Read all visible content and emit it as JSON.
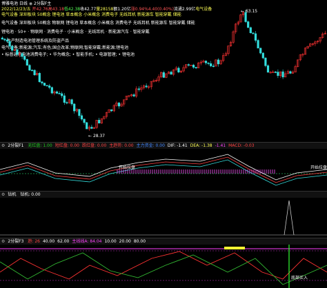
{
  "title_bar": {
    "text": "博雅电池 日线",
    "indicator": "2分裂F主"
  },
  "info_line": {
    "date": "2022/12/23/五",
    "items": [
      {
        "text": "开42.76",
        "color": "#ff5555"
      },
      {
        "text": "高43.18",
        "color": "#ff5555"
      },
      {
        "text": "低42.38",
        "color": "#55ff55"
      },
      {
        "text": "收42.77",
        "color": "#ffffff"
      },
      {
        "text": "量28158",
        "color": "#ffff55"
      },
      {
        "text": "额1.20亿",
        "color": "#ffffff"
      },
      {
        "text": "涨0.94%",
        "color": "#ff5555"
      },
      {
        "text": "4.40(0.40%)",
        "color": "#ff5555"
      },
      {
        "text": "流通2.99亿",
        "color": "#ffffff"
      },
      {
        "text": "电气设备",
        "color": "#ffff55"
      }
    ]
  },
  "concept_lines": [
    {
      "text": "电气设备  深圳板块  50概念  锂电池  草本概念  小米概念  消费电子  无线耳机  新能源车  智能穿戴  储能",
      "color": "#ffff55"
    },
    {
      "text": "电气设备  深圳板块  50概念  物联网  锂电池  草本概念  小米概念  消费电子  无线耳机  新能源车  智能穿戴  储能",
      "color": "#ffffff"
    },
    {
      "text": "锂电池  ·  50+  ·  物联网  ·  消费电子  ·  小米概念  ·  无线耳机  ·  新能源汽车  ·  智能穿戴",
      "color": "#ffffff"
    }
  ],
  "business_lines": [
    "生产制造电池管理系统及防盗产品",
    "电气设备;新能源;汽车;有色;国企改革;物联网;智能穿戴;新能源;锂电池",
    "•  标普通用电池消费电子;  •  华为概念;  •  智能手机;  •  电源管理;  •  锂电池"
  ],
  "price_annotations": {
    "high": "63.15",
    "low": "28.37"
  },
  "macd_header": {
    "name": "2分裂F1",
    "items": [
      {
        "text": "无红盘: 1.00",
        "color": "#22cc22"
      },
      {
        "text": "短红盘: 0.00",
        "color": "#ff4444"
      },
      {
        "text": "跌红盘: 0.00",
        "color": "#ff4444"
      },
      {
        "text": "主趋势: 0.00",
        "color": "#ff4444"
      },
      {
        "text": "主力资金: 0.00",
        "color": "#4488ff"
      },
      {
        "text": "DIF: -1.41",
        "color": "#ffffff"
      },
      {
        "text": "DEA: -1.38",
        "color": "#ffff55"
      },
      {
        "text": "-1.41",
        "color": "#ff44ff"
      },
      {
        "text": "MACD: -0.03",
        "color": "#ff4444"
      }
    ],
    "labels": [
      "开始拉盘",
      "开始拉盘"
    ]
  },
  "signal_header": {
    "name": "钻机",
    "value_label": "钻机: 0.00"
  },
  "osc_header": {
    "name": "2分裂F3",
    "items": [
      {
        "text": "趋: 26",
        "color": "#ff4444"
      },
      {
        "text": "40.00",
        "color": "#ffffff"
      },
      {
        "text": "62.00",
        "color": "#ffffff"
      },
      {
        "text": "主线线A: 84.04",
        "color": "#ff44ff"
      },
      {
        "text": "10.00",
        "color": "#ffffff"
      },
      {
        "text": "20.00",
        "color": "#ffffff"
      },
      {
        "text": "80.00",
        "color": "#ffffff"
      }
    ],
    "bottom_label": "底部买入"
  },
  "colors": {
    "up": "#ff3333",
    "down": "#33dddd",
    "bg": "#000000",
    "panel_line": "#444444"
  }
}
